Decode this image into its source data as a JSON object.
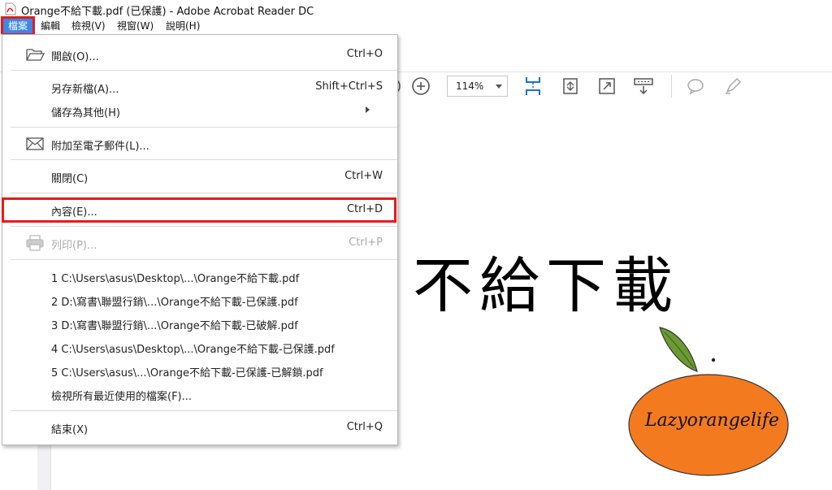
{
  "window": {
    "title": "Orange不給下載.pdf (已保護) - Adobe Acrobat Reader DC"
  },
  "menubar": {
    "items": [
      {
        "label": "檔案",
        "active": true
      },
      {
        "label": "編輯"
      },
      {
        "label": "檢視(V)"
      },
      {
        "label": "視窗(W)"
      },
      {
        "label": "說明(H)"
      }
    ]
  },
  "toolbar": {
    "zoom": "114%",
    "icons": [
      "zoom-in-icon",
      "fit-page-icon",
      "rotate-icon",
      "fullscreen-icon",
      "scroll-mode-icon",
      "comment-icon",
      "highlight-pen-icon"
    ]
  },
  "file_menu": {
    "open": {
      "label": "開啟(O)...",
      "shortcut": "Ctrl+O"
    },
    "save_as": {
      "label": "另存新檔(A)...",
      "shortcut": "Shift+Ctrl+S"
    },
    "save_as_other": {
      "label": "儲存為其他(H)"
    },
    "attach_email": {
      "label": "附加至電子郵件(L)..."
    },
    "close": {
      "label": "關閉(C)",
      "shortcut": "Ctrl+W"
    },
    "properties": {
      "label": "內容(E)...",
      "shortcut": "Ctrl+D"
    },
    "print": {
      "label": "列印(P)...",
      "shortcut": "Ctrl+P",
      "disabled": true
    },
    "recent": [
      "1 C:\\Users\\asus\\Desktop\\...\\Orange不給下載.pdf",
      "2 D:\\寫書\\聯盟行銷\\...\\Orange不給下載-已保護.pdf",
      "3 D:\\寫書\\聯盟行銷\\...\\Orange不給下載-已破解.pdf",
      "4 C:\\Users\\asus\\Desktop\\...\\Orange不給下載-已保護.pdf",
      "5 C:\\Users\\asus\\...\\Orange不給下載-已保護-已解鎖.pdf"
    ],
    "view_all_recent": {
      "label": "檢視所有最近使用的檔案(F)..."
    },
    "exit": {
      "label": "結束(X)",
      "shortcut": "Ctrl+Q"
    }
  },
  "document": {
    "heading": "不給下載",
    "logo_text": "Lazyorangelife"
  },
  "colors": {
    "highlight_red": "#e51b1b",
    "menu_active": "#3b88e8",
    "toolbar_blue": "#1a73c9",
    "orange": "#f47a20"
  }
}
